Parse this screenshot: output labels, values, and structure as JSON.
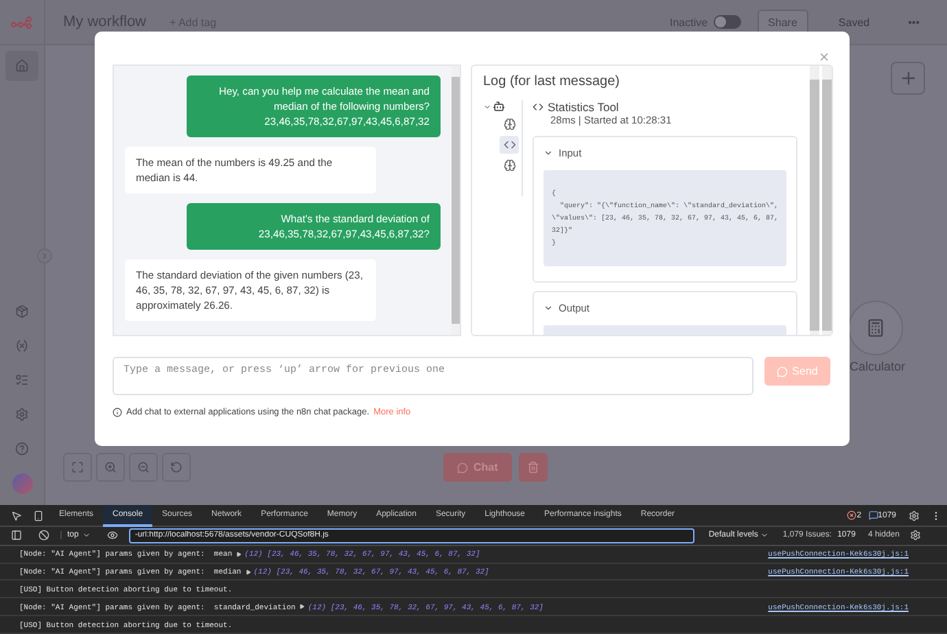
{
  "header": {
    "title": "My workflow",
    "add_tag": "+ Add tag",
    "status": "Inactive",
    "active": false,
    "share": "Share",
    "saved": "Saved",
    "more": "•••"
  },
  "canvas": {
    "node_label": "Calculator",
    "chat_button": "Chat"
  },
  "chat": {
    "messages": [
      {
        "kind": "user",
        "text": "Hey, can you help me calculate the mean and median of the following numbers? 23,46,35,78,32,67,97,43,45,6,87,32"
      },
      {
        "kind": "bot",
        "text": "The mean of the numbers is 49.25 and the median is 44."
      },
      {
        "kind": "user",
        "text": "What's the standard deviation of 23,46,35,78,32,67,97,43,45,6,87,32?"
      },
      {
        "kind": "bot",
        "text": "The standard deviation of the given numbers (23, 46, 35, 78, 32, 67, 97, 43, 45, 6, 87, 32) is approximately 26.26."
      }
    ],
    "placeholder": "Type a message, or press ‘up’ arrow for previous one",
    "send": "Send",
    "info": "Add chat to external applications using the n8n chat package.",
    "info_link": "More info"
  },
  "log": {
    "title": "Log (for last message)",
    "tree": {
      "kind": "agent",
      "expanded": true,
      "children": [
        {
          "kind": "model",
          "selected": false
        },
        {
          "kind": "tool",
          "selected": true
        },
        {
          "kind": "model",
          "selected": false
        }
      ]
    },
    "tool_name": "Statistics Tool",
    "meta": "28ms | Started at 10:28:31",
    "sections": [
      {
        "title": "Input",
        "expanded": true,
        "lines": [
          "{",
          "  \"query\": \"{\\\"function_name\\\": \\\"standard_deviation\\\",",
          "\\\"values\\\": [23, 46, 35, 78, 32, 67, 97, 43, 45, 6, 87,",
          "32]}\"",
          "}"
        ]
      },
      {
        "title": "Output",
        "expanded": true
      }
    ]
  },
  "devtools": {
    "tabs": [
      {
        "label": "Elements",
        "selected": false
      },
      {
        "label": "Console",
        "selected": true
      },
      {
        "label": "Sources",
        "selected": false
      },
      {
        "label": "Network",
        "selected": false
      },
      {
        "label": "Performance",
        "selected": false
      },
      {
        "label": "Memory",
        "selected": false
      },
      {
        "label": "Application",
        "selected": false
      },
      {
        "label": "Security",
        "selected": false
      },
      {
        "label": "Lighthouse",
        "selected": false
      },
      {
        "label": "Performance insights",
        "selected": false
      },
      {
        "label": "Recorder",
        "selected": false
      }
    ],
    "errors": "2",
    "messages": "1079",
    "context": "top",
    "filter": "-url:http://localhost:5678/assets/vendor-CUQSof8H.js",
    "levels": "Default levels",
    "issues_label": "1,079 Issues:",
    "issues_count": "1079",
    "hidden": "4 hidden",
    "rows": [
      {
        "text": "[Node: \"AI Agent\"] params given by agent:  mean",
        "array": "(12) [23, 46, 35, 78, 32, 67, 97, 43, 45, 6, 87, 32]",
        "source": "usePushConnection-Kek6s30j.js:1"
      },
      {
        "text": "[Node: \"AI Agent\"] params given by agent:  median",
        "array": "(12) [23, 46, 35, 78, 32, 67, 97, 43, 45, 6, 87, 32]",
        "source": "usePushConnection-Kek6s30j.js:1"
      },
      {
        "text": "[USO] Button detection aborting due to timeout."
      },
      {
        "text": "[Node: \"AI Agent\"] params given by agent:  standard_deviation",
        "array": "(12) [23, 46, 35, 78, 32, 67, 97, 43, 45, 6, 87, 32]",
        "source": "usePushConnection-Kek6s30j.js:1"
      },
      {
        "text": "[USO] Button detection aborting due to timeout."
      }
    ]
  }
}
